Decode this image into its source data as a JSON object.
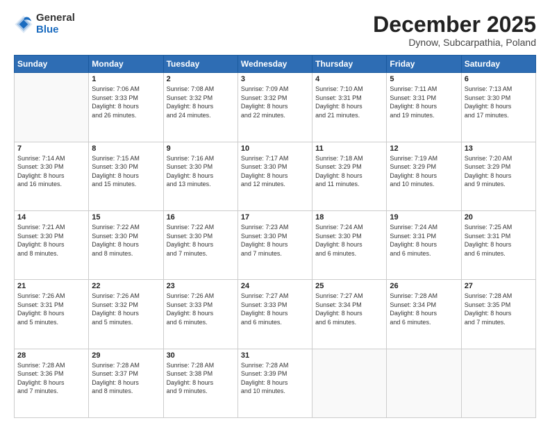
{
  "header": {
    "logo": {
      "general": "General",
      "blue": "Blue"
    },
    "title": "December 2025",
    "location": "Dynow, Subcarpathia, Poland"
  },
  "calendar": {
    "days_of_week": [
      "Sunday",
      "Monday",
      "Tuesday",
      "Wednesday",
      "Thursday",
      "Friday",
      "Saturday"
    ],
    "weeks": [
      [
        {
          "day": "",
          "info": ""
        },
        {
          "day": "1",
          "info": "Sunrise: 7:06 AM\nSunset: 3:33 PM\nDaylight: 8 hours\nand 26 minutes."
        },
        {
          "day": "2",
          "info": "Sunrise: 7:08 AM\nSunset: 3:32 PM\nDaylight: 8 hours\nand 24 minutes."
        },
        {
          "day": "3",
          "info": "Sunrise: 7:09 AM\nSunset: 3:32 PM\nDaylight: 8 hours\nand 22 minutes."
        },
        {
          "day": "4",
          "info": "Sunrise: 7:10 AM\nSunset: 3:31 PM\nDaylight: 8 hours\nand 21 minutes."
        },
        {
          "day": "5",
          "info": "Sunrise: 7:11 AM\nSunset: 3:31 PM\nDaylight: 8 hours\nand 19 minutes."
        },
        {
          "day": "6",
          "info": "Sunrise: 7:13 AM\nSunset: 3:30 PM\nDaylight: 8 hours\nand 17 minutes."
        }
      ],
      [
        {
          "day": "7",
          "info": "Sunrise: 7:14 AM\nSunset: 3:30 PM\nDaylight: 8 hours\nand 16 minutes."
        },
        {
          "day": "8",
          "info": "Sunrise: 7:15 AM\nSunset: 3:30 PM\nDaylight: 8 hours\nand 15 minutes."
        },
        {
          "day": "9",
          "info": "Sunrise: 7:16 AM\nSunset: 3:30 PM\nDaylight: 8 hours\nand 13 minutes."
        },
        {
          "day": "10",
          "info": "Sunrise: 7:17 AM\nSunset: 3:30 PM\nDaylight: 8 hours\nand 12 minutes."
        },
        {
          "day": "11",
          "info": "Sunrise: 7:18 AM\nSunset: 3:29 PM\nDaylight: 8 hours\nand 11 minutes."
        },
        {
          "day": "12",
          "info": "Sunrise: 7:19 AM\nSunset: 3:29 PM\nDaylight: 8 hours\nand 10 minutes."
        },
        {
          "day": "13",
          "info": "Sunrise: 7:20 AM\nSunset: 3:29 PM\nDaylight: 8 hours\nand 9 minutes."
        }
      ],
      [
        {
          "day": "14",
          "info": "Sunrise: 7:21 AM\nSunset: 3:30 PM\nDaylight: 8 hours\nand 8 minutes."
        },
        {
          "day": "15",
          "info": "Sunrise: 7:22 AM\nSunset: 3:30 PM\nDaylight: 8 hours\nand 8 minutes."
        },
        {
          "day": "16",
          "info": "Sunrise: 7:22 AM\nSunset: 3:30 PM\nDaylight: 8 hours\nand 7 minutes."
        },
        {
          "day": "17",
          "info": "Sunrise: 7:23 AM\nSunset: 3:30 PM\nDaylight: 8 hours\nand 7 minutes."
        },
        {
          "day": "18",
          "info": "Sunrise: 7:24 AM\nSunset: 3:30 PM\nDaylight: 8 hours\nand 6 minutes."
        },
        {
          "day": "19",
          "info": "Sunrise: 7:24 AM\nSunset: 3:31 PM\nDaylight: 8 hours\nand 6 minutes."
        },
        {
          "day": "20",
          "info": "Sunrise: 7:25 AM\nSunset: 3:31 PM\nDaylight: 8 hours\nand 6 minutes."
        }
      ],
      [
        {
          "day": "21",
          "info": "Sunrise: 7:26 AM\nSunset: 3:31 PM\nDaylight: 8 hours\nand 5 minutes."
        },
        {
          "day": "22",
          "info": "Sunrise: 7:26 AM\nSunset: 3:32 PM\nDaylight: 8 hours\nand 5 minutes."
        },
        {
          "day": "23",
          "info": "Sunrise: 7:26 AM\nSunset: 3:33 PM\nDaylight: 8 hours\nand 6 minutes."
        },
        {
          "day": "24",
          "info": "Sunrise: 7:27 AM\nSunset: 3:33 PM\nDaylight: 8 hours\nand 6 minutes."
        },
        {
          "day": "25",
          "info": "Sunrise: 7:27 AM\nSunset: 3:34 PM\nDaylight: 8 hours\nand 6 minutes."
        },
        {
          "day": "26",
          "info": "Sunrise: 7:28 AM\nSunset: 3:34 PM\nDaylight: 8 hours\nand 6 minutes."
        },
        {
          "day": "27",
          "info": "Sunrise: 7:28 AM\nSunset: 3:35 PM\nDaylight: 8 hours\nand 7 minutes."
        }
      ],
      [
        {
          "day": "28",
          "info": "Sunrise: 7:28 AM\nSunset: 3:36 PM\nDaylight: 8 hours\nand 7 minutes."
        },
        {
          "day": "29",
          "info": "Sunrise: 7:28 AM\nSunset: 3:37 PM\nDaylight: 8 hours\nand 8 minutes."
        },
        {
          "day": "30",
          "info": "Sunrise: 7:28 AM\nSunset: 3:38 PM\nDaylight: 8 hours\nand 9 minutes."
        },
        {
          "day": "31",
          "info": "Sunrise: 7:28 AM\nSunset: 3:39 PM\nDaylight: 8 hours\nand 10 minutes."
        },
        {
          "day": "",
          "info": ""
        },
        {
          "day": "",
          "info": ""
        },
        {
          "day": "",
          "info": ""
        }
      ]
    ]
  }
}
